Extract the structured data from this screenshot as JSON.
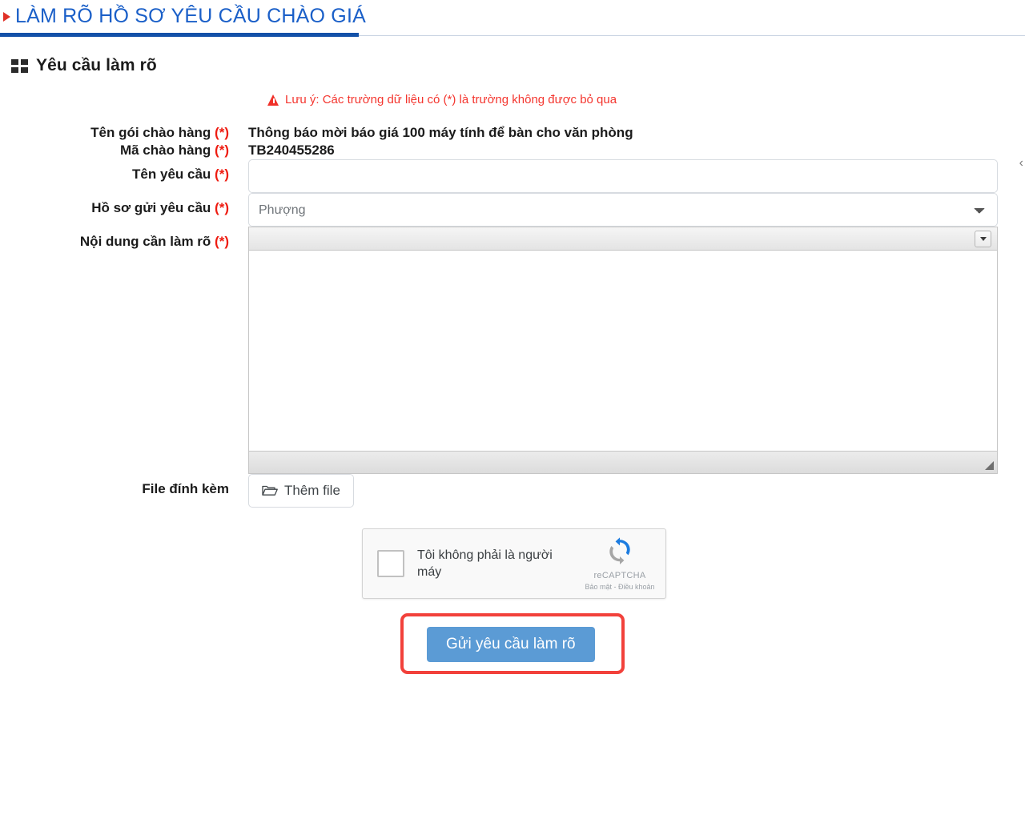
{
  "header": {
    "title": "LÀM RÕ HỒ SƠ YÊU CẦU CHÀO GIÁ",
    "bullet_icon": "red-triangle-icon",
    "accent_color": "#1351a8",
    "title_color": "#1a5fc8"
  },
  "section": {
    "icon": "grid-icon",
    "title": "Yêu cầu làm rõ"
  },
  "note": {
    "icon": "warning-triangle-icon",
    "text": "Lưu ý: Các trường dữ liệu có (*) là trường không được bỏ qua",
    "color": "#f4352e"
  },
  "form": {
    "required_marker": "(*)",
    "package_name": {
      "label": "Tên gói chào hàng",
      "value": "Thông báo mời báo giá 100 máy tính để bàn cho văn phòng"
    },
    "package_code": {
      "label": "Mã chào hàng",
      "value": "TB240455286"
    },
    "request_name": {
      "label": "Tên yêu cầu",
      "value": "",
      "placeholder": ""
    },
    "submitting_document": {
      "label": "Hồ sơ gửi yêu cầu",
      "selected": "Phượng",
      "options": [
        "Phượng"
      ]
    },
    "clarification_content": {
      "label": "Nội dung cần làm rõ",
      "value": "",
      "toolbar_expand_icon": "chevron-down-icon",
      "resize_icon": "resize-grip-icon"
    },
    "attachment": {
      "label": "File đính kèm",
      "button_label": "Thêm file",
      "button_icon": "folder-open-icon"
    }
  },
  "recaptcha": {
    "checkbox_label": "Tôi không phải là người máy",
    "brand": "reCAPTCHA",
    "terms": "Bảo mật - Điều khoản",
    "logo_icon": "recaptcha-logo-icon",
    "checked": false
  },
  "submit": {
    "label": "Gửi yêu cầu làm rõ",
    "color": "#5b9bd5",
    "highlight_color": "#f2413b"
  },
  "edge": {
    "collapse_icon": "chevron-left-icon",
    "glyph": "‹"
  }
}
